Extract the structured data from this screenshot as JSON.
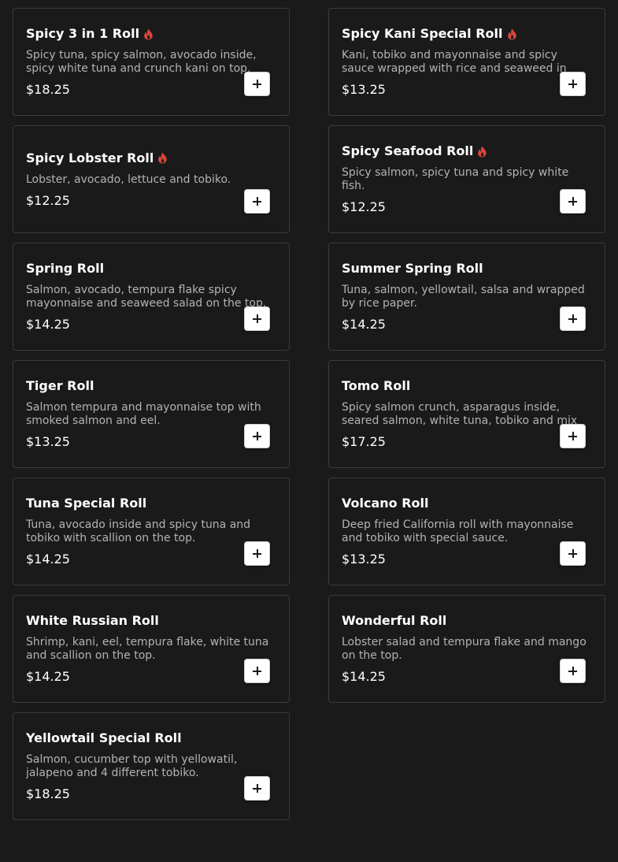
{
  "menu": {
    "items": [
      {
        "name": "Spicy 3 in 1 Roll",
        "spicy": true,
        "description": "Spicy tuna, spicy salmon, avocado inside, spicy white tuna and crunch kani on top.",
        "price": "$18.25",
        "icon": "plus-icon"
      },
      {
        "name": "Spicy Kani Special Roll",
        "spicy": true,
        "description": "Kani, tobiko and mayonnaise and spicy sauce wrapped with rice and seaweed in",
        "price": "$13.25",
        "icon": "plus-icon"
      },
      {
        "name": "Spicy Lobster Roll",
        "spicy": true,
        "description": "Lobster, avocado, lettuce and tobiko.",
        "price": "$12.25",
        "icon": "plus-icon"
      },
      {
        "name": "Spicy Seafood Roll",
        "spicy": true,
        "description": "Spicy salmon, spicy tuna and spicy white fish.",
        "price": "$12.25",
        "icon": "plus-icon"
      },
      {
        "name": "Spring Roll",
        "spicy": false,
        "description": "Salmon, avocado, tempura flake spicy mayonnaise and seaweed salad on the top.",
        "price": "$14.25",
        "icon": "plus-icon"
      },
      {
        "name": "Summer Spring Roll",
        "spicy": false,
        "description": "Tuna, salmon, yellowtail, salsa and wrapped by rice paper.",
        "price": "$14.25",
        "icon": "plus-icon"
      },
      {
        "name": "Tiger Roll",
        "spicy": false,
        "description": "Salmon tempura and mayonnaise top with smoked salmon and eel.",
        "price": "$13.25",
        "icon": "plus-icon"
      },
      {
        "name": "Tomo Roll",
        "spicy": false,
        "description": "Spicy salmon crunch, asparagus inside, seared salmon, white tuna, tobiko and mix",
        "price": "$17.25",
        "icon": "plus-icon"
      },
      {
        "name": "Tuna Special Roll",
        "spicy": false,
        "description": "Tuna, avocado inside and spicy tuna and tobiko with scallion on the top.",
        "price": "$14.25",
        "icon": "plus-icon"
      },
      {
        "name": "Volcano Roll",
        "spicy": false,
        "description": "Deep fried California roll with mayonnaise and tobiko with special sauce.",
        "price": "$13.25",
        "icon": "plus-icon"
      },
      {
        "name": "White Russian Roll",
        "spicy": false,
        "description": "Shrimp, kani, eel, tempura flake, white tuna and scallion on the top.",
        "price": "$14.25",
        "icon": "plus-icon"
      },
      {
        "name": "Wonderful Roll",
        "spicy": false,
        "description": "Lobster salad and tempura flake and mango on the top.",
        "price": "$14.25",
        "icon": "plus-icon"
      },
      {
        "name": "Yellowtail Special Roll",
        "spicy": false,
        "description": "Salmon, cucumber top with yellowatil, jalapeno and 4 different tobiko.",
        "price": "$18.25",
        "icon": "plus-icon"
      }
    ]
  },
  "colors": {
    "background": "#1a1a1a",
    "card_border": "#3b3b3b",
    "title": "#ffffff",
    "description": "#b3b3b3",
    "spicy_icon": "#d9463e",
    "add_button": "#ffffff"
  }
}
